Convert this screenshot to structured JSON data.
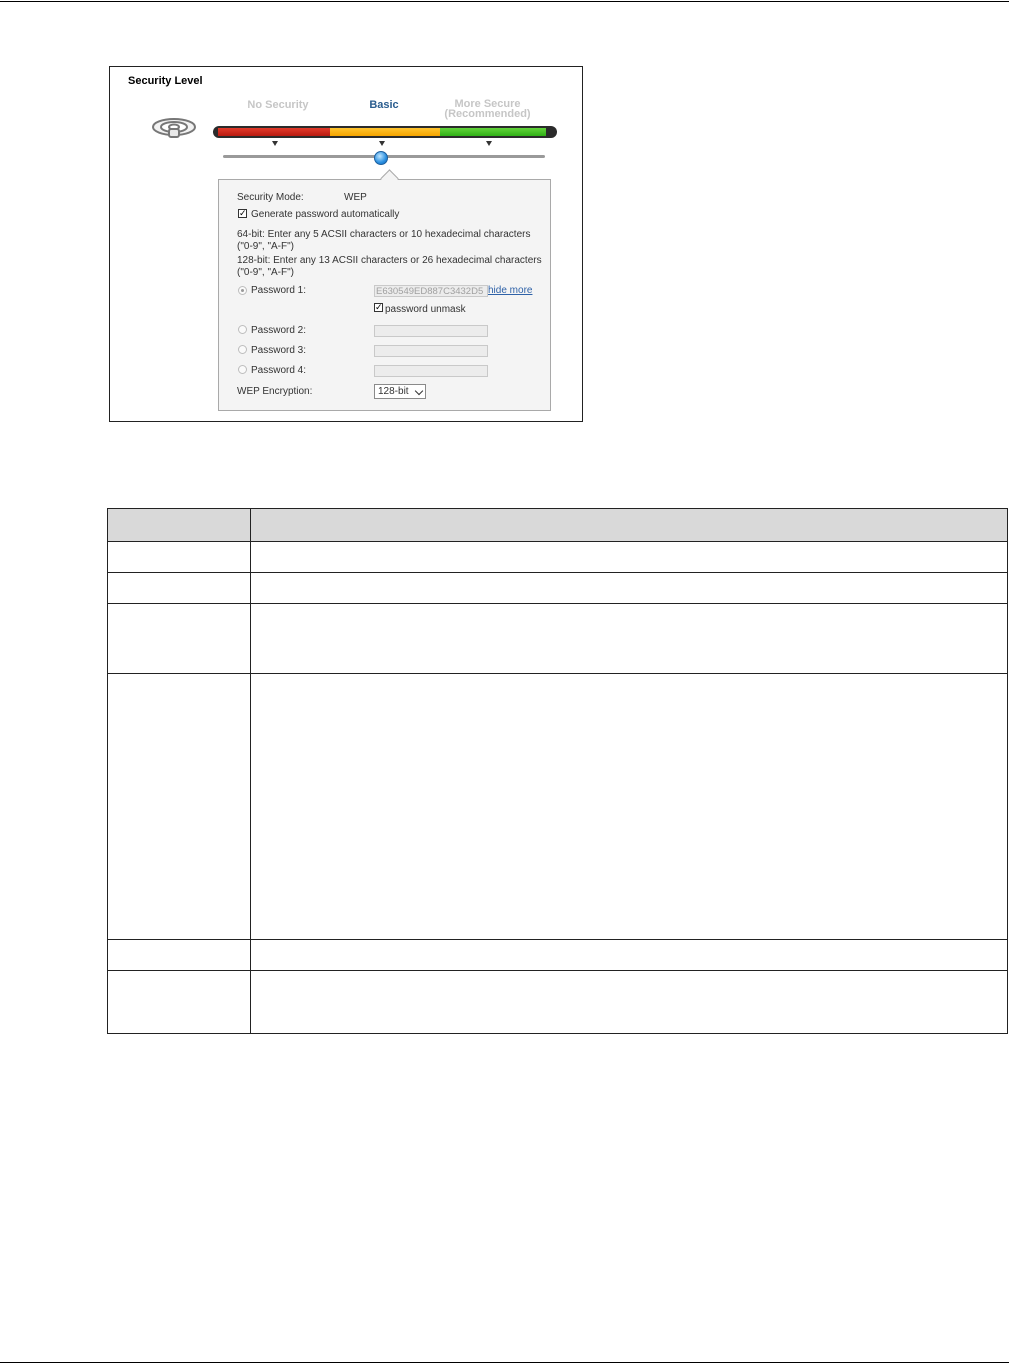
{
  "security": {
    "title": "Security Level",
    "levels": {
      "none": "No Security",
      "basic": "Basic",
      "more_line1": "More Secure",
      "more_line2": "(Recommended)"
    },
    "colors": {
      "red": "#c8261a",
      "yellow": "#f8b512",
      "green": "#45c025",
      "active": "#2a5d8f"
    },
    "slider_position": "basic"
  },
  "panel": {
    "mode_label": "Security Mode:",
    "mode_value": "WEP",
    "generate_label": "Generate password automatically",
    "generate_checked": true,
    "hint64_line1": "64-bit: Enter any 5 ACSII characters or 10 hexadecimal characters",
    "hint64_line2": "(\"0-9\", \"A-F\")",
    "hint128_line1": "128-bit: Enter any 13 ACSII characters or 26 hexadecimal characters",
    "hint128_line2": "(\"0-9\", \"A-F\")",
    "password1_label": "Password 1:",
    "password1_value": "E630549ED887C3432D5",
    "hide_more": "hide more",
    "unmask_label": "password unmask",
    "unmask_checked": true,
    "password2_label": "Password 2:",
    "password2_value": "",
    "password3_label": "Password 3:",
    "password3_value": "",
    "password4_label": "Password 4:",
    "password4_value": "",
    "encryption_label": "WEP Encryption:",
    "encryption_value": "128-bit"
  },
  "icons": {
    "wifi": "wifi-router-icon",
    "check": "✓"
  },
  "table": {
    "rows": [
      {
        "label": "",
        "description": ""
      },
      {
        "label": "",
        "description": ""
      },
      {
        "label": "",
        "description": ""
      },
      {
        "label": "",
        "description": ""
      },
      {
        "label": "",
        "description": ""
      },
      {
        "label": "",
        "description": ""
      },
      {
        "label": "",
        "description": ""
      }
    ]
  }
}
